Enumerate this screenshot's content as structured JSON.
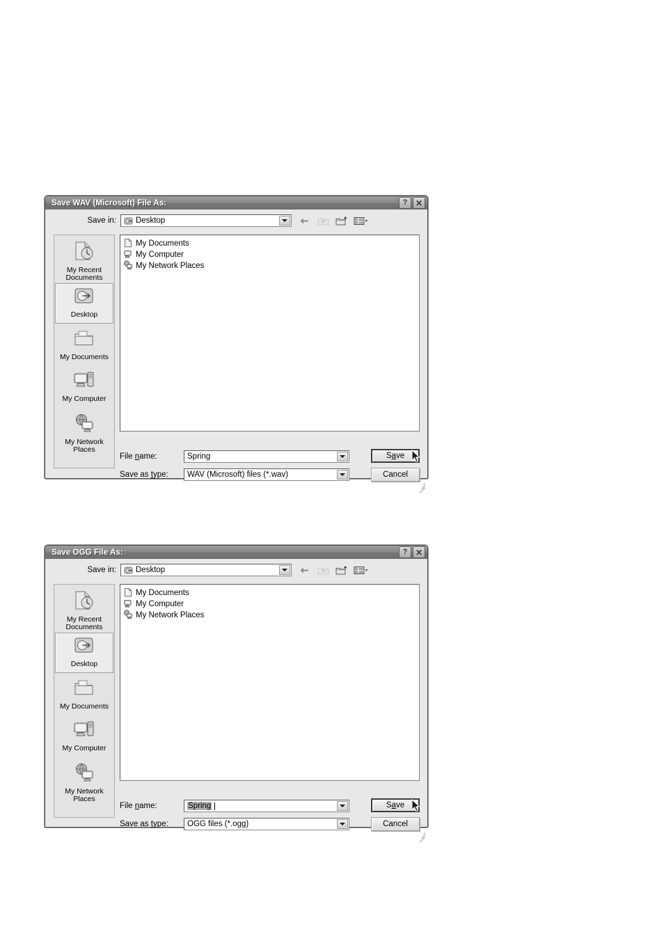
{
  "page": {
    "background": "#ffffff",
    "title_bar_color": "#7f7f7f",
    "dialog_face_color": "#e8e8e8",
    "selection_color": "#b0b0b0"
  },
  "dialogs": [
    {
      "id": "save-wav",
      "title": "Save WAV (Microsoft) File As:",
      "help_button": "?",
      "close_button": "✕",
      "save_in": {
        "label": "Save in:",
        "value": "Desktop",
        "icon": "desktop-icon"
      },
      "toolbar": [
        {
          "name": "back-icon",
          "label": "Back",
          "enabled": true
        },
        {
          "name": "up-one-level-icon",
          "label": "Up One Level",
          "enabled": false
        },
        {
          "name": "create-new-folder-icon",
          "label": "Create New Folder",
          "enabled": true
        },
        {
          "name": "views-icon",
          "label": "Views",
          "enabled": true
        }
      ],
      "places": [
        {
          "label": "My Recent\nDocuments",
          "icon": "recent-documents-icon",
          "selected": false
        },
        {
          "label": "Desktop",
          "icon": "desktop-icon",
          "selected": true
        },
        {
          "label": "My Documents",
          "icon": "my-documents-icon",
          "selected": false
        },
        {
          "label": "My Computer",
          "icon": "my-computer-icon",
          "selected": false
        },
        {
          "label": "My Network\nPlaces",
          "icon": "my-network-places-icon",
          "selected": false
        }
      ],
      "files": [
        {
          "name": "My Documents",
          "icon": "folder-documents-icon"
        },
        {
          "name": "My Computer",
          "icon": "my-computer-icon"
        },
        {
          "name": "My Network Places",
          "icon": "my-network-places-icon"
        }
      ],
      "file_name": {
        "label": "File name:",
        "label_pre": "File ",
        "label_mnemonic": "n",
        "label_post": "ame:",
        "value": "Spring",
        "selected": false
      },
      "save_as_type": {
        "label": "Save as type:",
        "label_pre": "Save as ",
        "label_mnemonic": "t",
        "label_post": "ype:",
        "value": "WAV (Microsoft) files (*.wav)"
      },
      "buttons": {
        "save_pre": "S",
        "save_mnemonic": "a",
        "save_post": "ve",
        "save": "Save",
        "cancel": "Cancel"
      },
      "cursor_visible": true
    },
    {
      "id": "save-ogg",
      "title": "Save OGG File As:",
      "help_button": "?",
      "close_button": "✕",
      "save_in": {
        "label": "Save in:",
        "value": "Desktop",
        "icon": "desktop-icon"
      },
      "toolbar": [
        {
          "name": "back-icon",
          "label": "Back",
          "enabled": true
        },
        {
          "name": "up-one-level-icon",
          "label": "Up One Level",
          "enabled": false
        },
        {
          "name": "create-new-folder-icon",
          "label": "Create New Folder",
          "enabled": true
        },
        {
          "name": "views-icon",
          "label": "Views",
          "enabled": true
        }
      ],
      "places": [
        {
          "label": "My Recent\nDocuments",
          "icon": "recent-documents-icon",
          "selected": false
        },
        {
          "label": "Desktop",
          "icon": "desktop-icon",
          "selected": true
        },
        {
          "label": "My Documents",
          "icon": "my-documents-icon",
          "selected": false
        },
        {
          "label": "My Computer",
          "icon": "my-computer-icon",
          "selected": false
        },
        {
          "label": "My Network\nPlaces",
          "icon": "my-network-places-icon",
          "selected": false
        }
      ],
      "files": [
        {
          "name": "My Documents",
          "icon": "folder-documents-icon"
        },
        {
          "name": "My Computer",
          "icon": "my-computer-icon"
        },
        {
          "name": "My Network Places",
          "icon": "my-network-places-icon"
        }
      ],
      "file_name": {
        "label": "File name:",
        "label_pre": "File ",
        "label_mnemonic": "n",
        "label_post": "ame:",
        "value": "Spring",
        "selected": true
      },
      "save_as_type": {
        "label": "Save as type:",
        "label_pre": "Save as ",
        "label_mnemonic": "t",
        "label_post": "ype:",
        "value": "OGG files (*.ogg)"
      },
      "buttons": {
        "save_pre": "S",
        "save_mnemonic": "a",
        "save_post": "ve",
        "save": "Save",
        "cancel": "Cancel"
      },
      "cursor_visible": true
    }
  ]
}
